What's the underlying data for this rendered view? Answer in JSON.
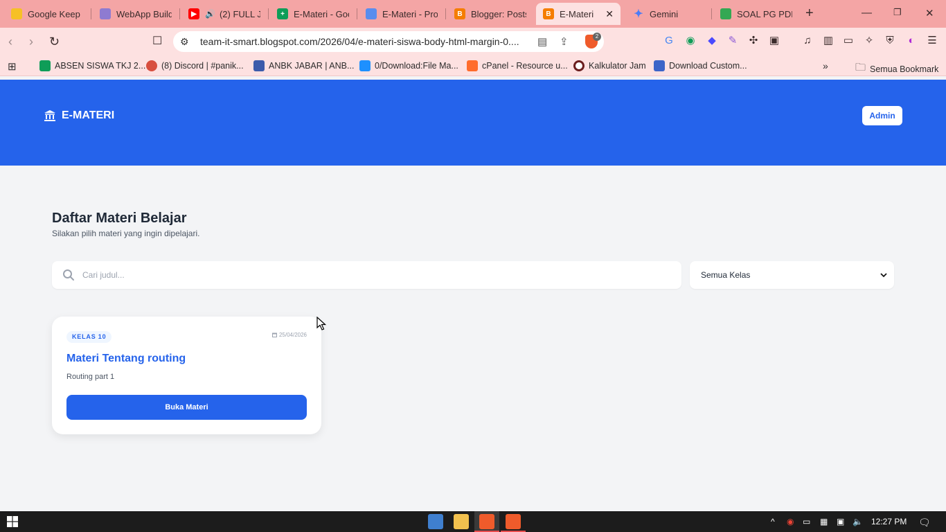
{
  "browser": {
    "tabs": [
      {
        "title": "Google Keep",
        "favicon_color": "#f6c026",
        "active": false
      },
      {
        "title": "WebApp Builde",
        "favicon_color": "#8e7bd1",
        "active": false
      },
      {
        "title": "(2) FULL JA",
        "favicon_color": "#ff0000",
        "active": false,
        "audio": true
      },
      {
        "title": "E-Materi - Goo",
        "favicon_color": "#0f9d58",
        "active": false
      },
      {
        "title": "E-Materi - Proj",
        "favicon_color": "#5a8dee",
        "active": false
      },
      {
        "title": "Blogger: Posts",
        "favicon_color": "#f57d00",
        "active": false
      },
      {
        "title": "E-Materi",
        "favicon_color": "#f57d00",
        "active": true
      },
      {
        "title": "Gemini",
        "favicon_color": "#4a7bf7",
        "active": false
      },
      {
        "title": "SOAL PG PDF -",
        "favicon_color": "#34a853",
        "active": false
      }
    ],
    "url_domain": "team-it-smart.blogspot.com",
    "url_path": "/2026/04/e-materi-siswa-body-html-margin-0....",
    "shield_count": "2",
    "bookmarks": [
      {
        "label": "ABSEN SISWA TKJ 2...",
        "color": "#0f9d58"
      },
      {
        "label": "(8) Discord | #panik...",
        "color": "#d84f3f"
      },
      {
        "label": "ANBK JABAR | ANB...",
        "color": "#3b5bab"
      },
      {
        "label": "0/Download:File Ma...",
        "color": "#1e90ff"
      },
      {
        "label": "cPanel - Resource u...",
        "color": "#ff6c2c"
      },
      {
        "label": "Kalkulator Jam",
        "color": "#6b1e1e"
      },
      {
        "label": "Download Custom...",
        "color": "#3c64c8"
      }
    ],
    "all_bookmarks_label": "Semua Bookmark"
  },
  "site": {
    "brand": "E-MATERI",
    "admin_label": "Admin",
    "page_title": "Daftar Materi Belajar",
    "page_subtitle": "Silakan pilih materi yang ingin dipelajari.",
    "search_placeholder": "Cari judul...",
    "class_filter": {
      "selected": "Semua Kelas"
    },
    "materials": [
      {
        "class_badge": "KELAS 10",
        "date": "25/04/2026",
        "title": "Materi Tentang routing",
        "description": "Routing part 1",
        "button_label": "Buka Materi"
      }
    ],
    "colors": {
      "primary": "#2563eb",
      "background": "#f3f4f6"
    }
  },
  "taskbar": {
    "time": "12:27 PM"
  }
}
